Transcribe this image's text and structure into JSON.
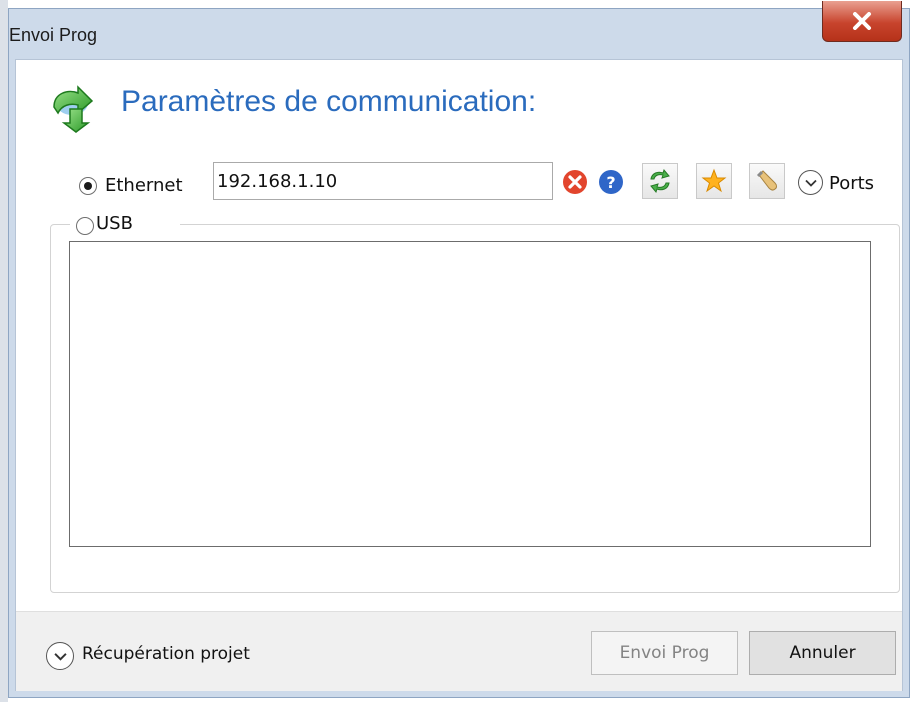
{
  "window": {
    "title": "Envoi Prog"
  },
  "header": {
    "title": "Paramètres de communication:",
    "icon": "green-download-arrow-icon"
  },
  "connection": {
    "ethernet": {
      "label": "Ethernet",
      "selected": true
    },
    "ip_value": "192.168.1.10",
    "usb": {
      "label": "USB",
      "selected": false
    },
    "ports_label": "Ports"
  },
  "toolbar_icons": [
    "clear-icon",
    "help-icon",
    "refresh-icon",
    "favorite-star-icon",
    "wrench-icon"
  ],
  "footer": {
    "recuperation_label": "Récupération projet",
    "send_label": "Envoi Prog",
    "cancel_label": "Annuler"
  },
  "colors": {
    "accent_title": "#2a6bbd",
    "frame": "#cddaea",
    "close_button": "#c8442d"
  }
}
